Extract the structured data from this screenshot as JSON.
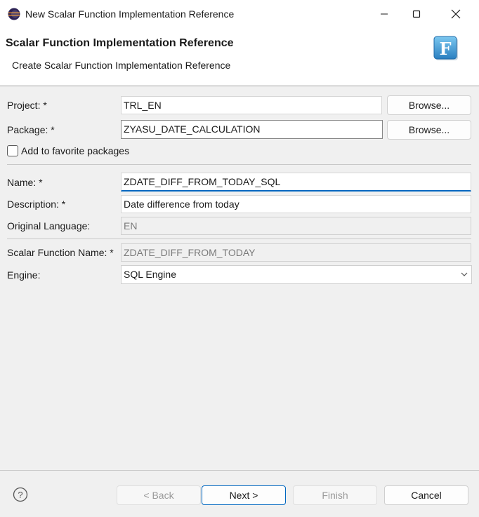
{
  "window": {
    "title": "New Scalar Function Implementation Reference"
  },
  "banner": {
    "title": "Scalar Function Implementation Reference",
    "description": "Create Scalar Function Implementation Reference"
  },
  "form": {
    "project": {
      "label": "Project: *",
      "value": "TRL_EN",
      "browse": "Browse..."
    },
    "package": {
      "label": "Package: *",
      "value": "ZYASU_DATE_CALCULATION",
      "browse": "Browse..."
    },
    "favorite": {
      "label": "Add to favorite packages",
      "checked": false
    },
    "name": {
      "label": "Name: *",
      "value": "ZDATE_DIFF_FROM_TODAY_SQL"
    },
    "description": {
      "label": "Description: *",
      "value": "Date difference from today"
    },
    "original_language": {
      "label": "Original Language:",
      "value": "EN"
    },
    "scalar_function_name": {
      "label": "Scalar Function Name: *",
      "value": "ZDATE_DIFF_FROM_TODAY"
    },
    "engine": {
      "label": "Engine:",
      "value": "SQL Engine"
    }
  },
  "footer": {
    "back": "< Back",
    "next": "Next >",
    "finish": "Finish",
    "cancel": "Cancel"
  },
  "icons": {
    "app": "eclipse-icon",
    "logo": "function-f-icon",
    "help": "help-icon",
    "dropdown": "chevron-down-icon"
  },
  "colors": {
    "accent": "#0067c0",
    "background": "#f0f0f0"
  }
}
